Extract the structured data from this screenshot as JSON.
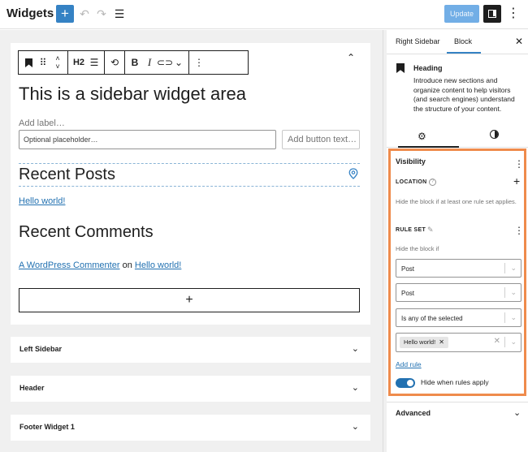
{
  "app": {
    "title": "Widgets"
  },
  "topbar": {
    "add_icon": "plus-icon",
    "undo_icon": "undo-icon",
    "redo_icon": "redo-icon",
    "list_view_icon": "list-view-icon",
    "update_label": "Update",
    "settings_icon": "sidebar-panel-icon",
    "more_icon": "vertical-ellipsis-icon"
  },
  "block_toolbar": {
    "heading_level": "H2"
  },
  "widget_area": {
    "title": "This is a sidebar widget area",
    "add_label_placeholder": "Add label…",
    "input_placeholder": "Optional placeholder…",
    "button_placeholder": "Add button text…",
    "recent_posts_heading": "Recent Posts",
    "post_link": "Hello world!",
    "recent_comments_heading": "Recent Comments",
    "comment": {
      "author": "A WordPress Commenter",
      "on": "on",
      "post": "Hello world!"
    },
    "appender": "+"
  },
  "areas": [
    {
      "label": "Left Sidebar"
    },
    {
      "label": "Header"
    },
    {
      "label": "Footer Widget 1"
    }
  ],
  "sidebar": {
    "tabs": [
      "Right Sidebar",
      "Block"
    ],
    "active_tab": "Block",
    "block_card": {
      "title": "Heading",
      "description": "Introduce new sections and organize content to help visitors (and search engines) understand the structure of your content."
    },
    "visibility": {
      "title": "Visibility",
      "location_label": "LOCATION",
      "location_help": "Hide the block if at least one rule set applies.",
      "rule_set_label": "RULE SET",
      "rule_set_help": "Hide the block if",
      "selects": [
        "Post",
        "Post",
        "Is any of the selected"
      ],
      "chip": "Hello world!",
      "add_rule": "Add rule",
      "toggle_label": "Hide when rules apply",
      "toggle_on": true
    },
    "advanced_label": "Advanced"
  },
  "colors": {
    "accent": "#3582c4",
    "highlight_border": "#ef8b4c",
    "link": "#2271b1"
  }
}
